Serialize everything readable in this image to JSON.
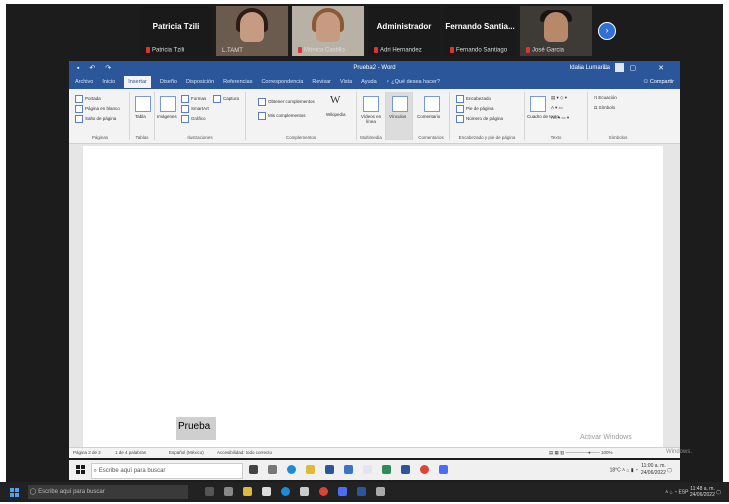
{
  "participants": [
    {
      "name": "Patricia Tzili",
      "label": "Patricia Tzili",
      "video": false
    },
    {
      "name": "",
      "label": "L.TAMT",
      "video": true
    },
    {
      "name": "",
      "label": "Mónica Castillo",
      "video": true
    },
    {
      "name": "Administrador",
      "label": "Adri Hernandez",
      "video": false
    },
    {
      "name": "Fernando Santia...",
      "label": "Fernando Santiago",
      "video": false
    },
    {
      "name": "",
      "label": "José Garcia",
      "video": true
    }
  ],
  "nav_icon": "chevron-right-icon",
  "word": {
    "doc_title": "Prueba2 - Word",
    "user": "Idalia Lumarilla",
    "share": "Compartir",
    "tabs": [
      "Archivo",
      "Inicio",
      "Insertar",
      "Diseño",
      "Disposición",
      "Referencias",
      "Correspondencia",
      "Revisar",
      "Vista",
      "Ayuda",
      "¿Qué desea hacer?"
    ],
    "ribbon": {
      "paginas": {
        "items": [
          "Portada",
          "Página en blanco",
          "Salto de página"
        ],
        "label": "Páginas"
      },
      "tablas": {
        "item": "Tabla",
        "label": "Tablas"
      },
      "ilustraciones": {
        "items": [
          "Imágenes",
          "Formas",
          "SmartArt",
          "Gráfico",
          "Captura"
        ],
        "label": "Ilustraciones"
      },
      "complementos": {
        "items": [
          "Obtener complementos",
          "Mis complementos",
          "Wikipedia"
        ],
        "label": "Complementos"
      },
      "multimedia": {
        "item": "Vídeos en línea",
        "label": "Multimedia"
      },
      "vinculos": {
        "item": "Vínculos"
      },
      "comentarios": {
        "item": "Comentario",
        "label": "Comentarios"
      },
      "encabezado": {
        "items": [
          "Encabezado",
          "Pie de página",
          "Número de página"
        ],
        "label": "Encabezado y pie de página"
      },
      "texto": {
        "item": "Cuadro de texto",
        "label": "Texto"
      },
      "simbolos": {
        "items": [
          "Ecuación",
          "Símbolo"
        ],
        "label": "Símbolos"
      }
    },
    "body_text": "Prueba",
    "status": {
      "page": "Página 2 de 2",
      "words": "1 de 4 palabras",
      "lang": "Español (México)",
      "access": "Accesibilidad: todo correcto"
    }
  },
  "watermark": {
    "line1": "Activar Windows",
    "line2": "Windows."
  },
  "inner_taskbar": {
    "search": "Escribe aquí para buscar",
    "weather": "18°C",
    "time": "11:00 a. m.",
    "date": "24/06/2022"
  },
  "outer_taskbar": {
    "search": "Escribe aquí para buscar",
    "lang": "ESP",
    "time": "11:48 a. m.",
    "date": "24/06/2022"
  }
}
